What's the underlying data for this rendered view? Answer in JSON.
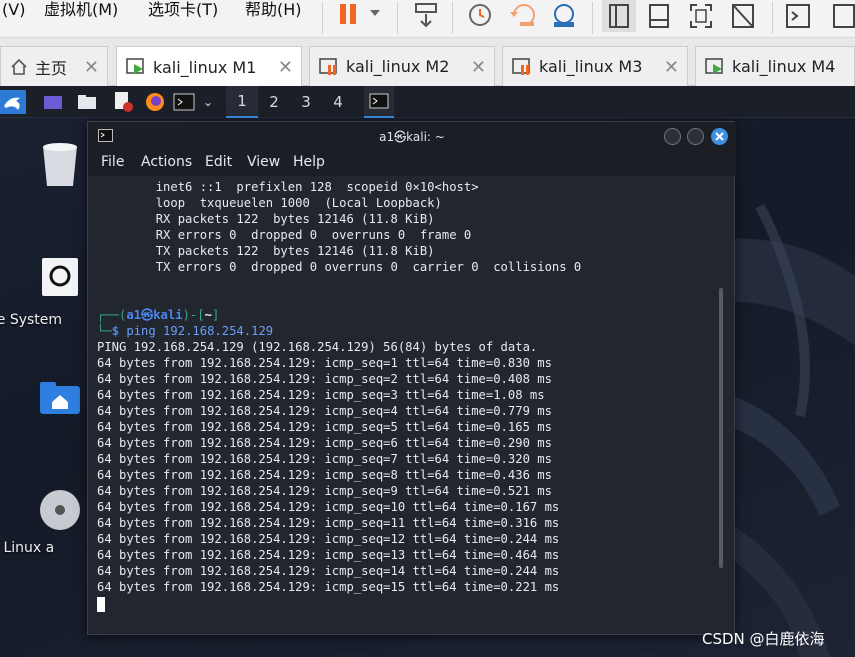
{
  "vmware": {
    "menu": [
      {
        "label": "(V)"
      },
      {
        "label": "虚拟机(M)"
      },
      {
        "label": "选项卡(T)"
      },
      {
        "label": "帮助(H)"
      }
    ],
    "colors": {
      "pause": "#f26522",
      "accent_orange": "#f26522"
    }
  },
  "tabs": [
    {
      "label": "主页",
      "icon": "home-icon"
    },
    {
      "label": "kali_linux M1",
      "icon": "vm-running-icon",
      "active": true
    },
    {
      "label": "kali_linux M2",
      "icon": "vm-paused-icon"
    },
    {
      "label": "kali_linux M3",
      "icon": "vm-paused-icon"
    },
    {
      "label": "kali_linux M4",
      "icon": "vm-running-icon"
    }
  ],
  "kali_panel": {
    "workspaces": [
      "1",
      "2",
      "3",
      "4"
    ],
    "active_workspace": "1"
  },
  "desktop_icons": [
    {
      "label": "Trash",
      "icon": "trash-icon"
    },
    {
      "label": "File System",
      "icon": "file-system-icon"
    },
    {
      "label": "Home",
      "icon": "home-folder-icon"
    },
    {
      "label": "Kali Linux a",
      "icon": "disc-icon"
    }
  ],
  "terminal": {
    "title": "a1㉿kali: ~",
    "menu": [
      "File",
      "Actions",
      "Edit",
      "View",
      "Help"
    ],
    "pre_lines": [
      "        inet6 ::1  prefixlen 128  scopeid 0×10<host>",
      "        loop  txqueuelen 1000  (Local Loopback)",
      "        RX packets 122  bytes 12146 (11.8 KiB)",
      "        RX errors 0  dropped 0  overruns 0  frame 0",
      "        TX packets 122  bytes 12146 (11.8 KiB)",
      "        TX errors 0  dropped 0 overruns 0  carrier 0  collisions 0"
    ],
    "prompt": {
      "user": "a1㉿kali",
      "path": "~",
      "command": "ping 192.168.254.129"
    },
    "output": [
      "PING 192.168.254.129 (192.168.254.129) 56(84) bytes of data.",
      "64 bytes from 192.168.254.129: icmp_seq=1 ttl=64 time=0.830 ms",
      "64 bytes from 192.168.254.129: icmp_seq=2 ttl=64 time=0.408 ms",
      "64 bytes from 192.168.254.129: icmp_seq=3 ttl=64 time=1.08 ms",
      "64 bytes from 192.168.254.129: icmp_seq=4 ttl=64 time=0.779 ms",
      "64 bytes from 192.168.254.129: icmp_seq=5 ttl=64 time=0.165 ms",
      "64 bytes from 192.168.254.129: icmp_seq=6 ttl=64 time=0.290 ms",
      "64 bytes from 192.168.254.129: icmp_seq=7 ttl=64 time=0.320 ms",
      "64 bytes from 192.168.254.129: icmp_seq=8 ttl=64 time=0.436 ms",
      "64 bytes from 192.168.254.129: icmp_seq=9 ttl=64 time=0.521 ms",
      "64 bytes from 192.168.254.129: icmp_seq=10 ttl=64 time=0.167 ms",
      "64 bytes from 192.168.254.129: icmp_seq=11 ttl=64 time=0.316 ms",
      "64 bytes from 192.168.254.129: icmp_seq=12 ttl=64 time=0.244 ms",
      "64 bytes from 192.168.254.129: icmp_seq=13 ttl=64 time=0.464 ms",
      "64 bytes from 192.168.254.129: icmp_seq=14 ttl=64 time=0.244 ms",
      "64 bytes from 192.168.254.129: icmp_seq=15 ttl=64 time=0.221 ms"
    ]
  },
  "watermark": "CSDN @白鹿依海"
}
